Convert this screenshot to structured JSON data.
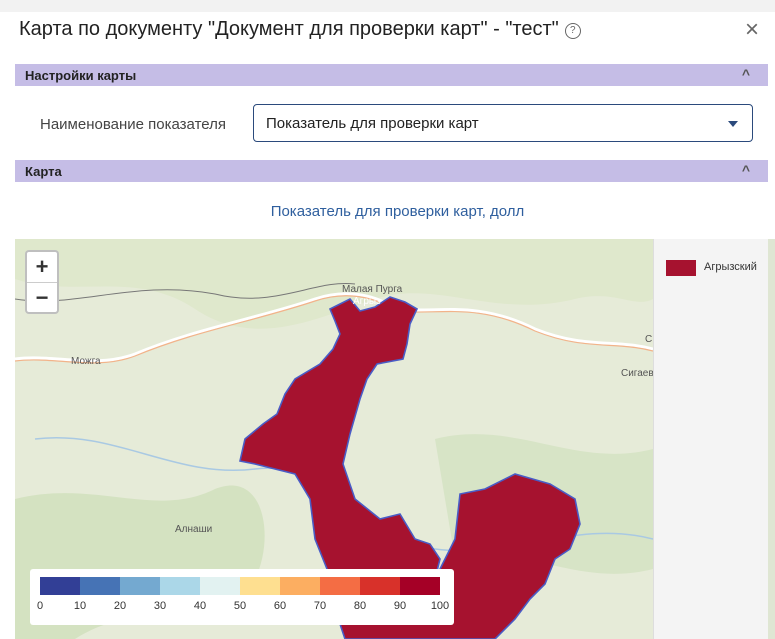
{
  "dialog": {
    "title": "Карта по документу \"Документ для проверки карт\" - \"тест\"",
    "help_icon": "question-circle-icon",
    "close_icon": "×"
  },
  "settings_section": {
    "label": "Настройки карты",
    "chevron": "^"
  },
  "indicator_field": {
    "label": "Наименование показателя",
    "value": "Показатель для проверки карт"
  },
  "map_section": {
    "label": "Карта",
    "chevron": "^"
  },
  "map": {
    "title": "Показатель для проверки карт, долл",
    "zoom_in": "+",
    "zoom_out": "−",
    "towns": [
      "Малая Пурга",
      "Агрыз",
      "Можга",
      "Алнаши",
      "Сигаево",
      "С"
    ],
    "region_color": "#a6122f",
    "legend": {
      "label": "Агрызский",
      "color": "#a6122f"
    },
    "scale": {
      "ticks": [
        "0",
        "10",
        "20",
        "30",
        "40",
        "50",
        "60",
        "70",
        "80",
        "90",
        "100"
      ],
      "colors": [
        "#323f96",
        "#4673b5",
        "#74a9d0",
        "#abd7e8",
        "#e2f2f1",
        "#fedf90",
        "#fcae61",
        "#f46d44",
        "#d8312a",
        "#a50026"
      ]
    }
  }
}
